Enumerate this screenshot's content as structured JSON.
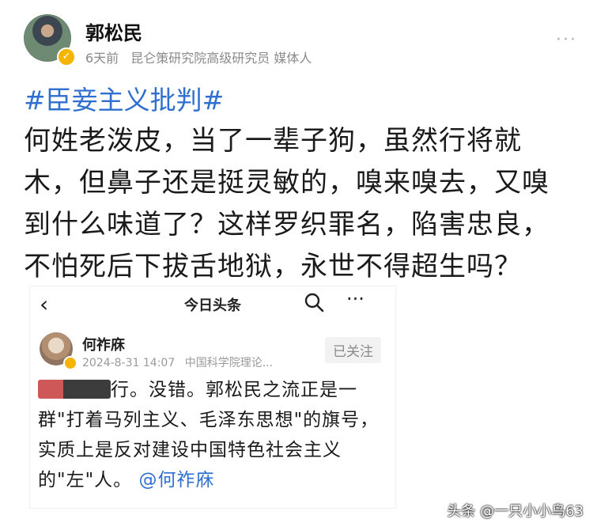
{
  "post": {
    "author": "郭松民",
    "time": "6天前",
    "title": "昆仑策研究院高级研究员 媒体人",
    "more": "···",
    "hashtag": "#臣妾主义批判#",
    "body": "何姓老泼皮，当了一辈子狗，虽然行将就木，但鼻子还是挺灵敏的，嗅来嗅去，又嗅到什么味道了？这样罗织罪名，陷害忠良，不怕死后下拔舌地狱，永世不得超生吗？"
  },
  "embed": {
    "app_title": "今日头条",
    "back": "‹",
    "more": "···",
    "author": "何祚庥",
    "timestamp": "2024-8-31 14:07",
    "org": "中国科学院理论...",
    "follow_label": "已关注",
    "text_visible": "行。没错。郭松民之流正是一群\"打着马列主义、毛泽东思想\"的旗号，实质上是反对建设中国特色社会主义的\"左\"人。",
    "mention": "@何祚庥"
  },
  "watermark": "头条 @一只小小鸟63"
}
